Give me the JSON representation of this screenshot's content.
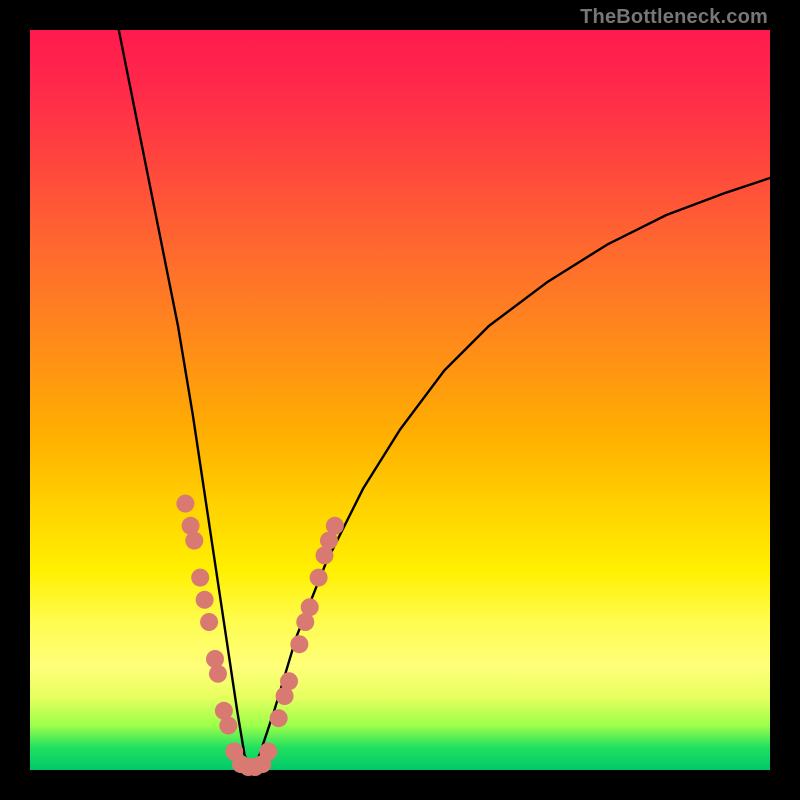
{
  "watermark": "TheBottleneck.com",
  "chart_data": {
    "type": "line",
    "title": "",
    "xlabel": "",
    "ylabel": "",
    "xlim": [
      0,
      100
    ],
    "ylim": [
      0,
      100
    ],
    "notes": "V-shaped bottleneck curve on a vertical gradient background (red top → green bottom). Salmon circular markers clustered near the valley. No axis ticks or labels rendered.",
    "series": [
      {
        "name": "bottleneck-curve",
        "x": [
          12,
          14,
          16,
          18,
          20,
          22,
          23.5,
          25,
          26.5,
          28,
          29,
          30,
          31,
          33,
          36,
          40,
          45,
          50,
          56,
          62,
          70,
          78,
          86,
          94,
          100
        ],
        "y": [
          100,
          90,
          80,
          70,
          60,
          48,
          38,
          28,
          18,
          8,
          2,
          0,
          2,
          8,
          18,
          28,
          38,
          46,
          54,
          60,
          66,
          71,
          75,
          78,
          80
        ]
      }
    ],
    "markers": [
      {
        "x": 21.0,
        "y": 36
      },
      {
        "x": 21.7,
        "y": 33
      },
      {
        "x": 22.2,
        "y": 31
      },
      {
        "x": 23.0,
        "y": 26
      },
      {
        "x": 23.6,
        "y": 23
      },
      {
        "x": 24.2,
        "y": 20
      },
      {
        "x": 25.0,
        "y": 15
      },
      {
        "x": 25.4,
        "y": 13
      },
      {
        "x": 26.2,
        "y": 8
      },
      {
        "x": 26.8,
        "y": 6
      },
      {
        "x": 27.6,
        "y": 2.5
      },
      {
        "x": 28.5,
        "y": 0.8
      },
      {
        "x": 29.5,
        "y": 0.4
      },
      {
        "x": 30.4,
        "y": 0.4
      },
      {
        "x": 31.4,
        "y": 0.8
      },
      {
        "x": 32.2,
        "y": 2.5
      },
      {
        "x": 33.6,
        "y": 7
      },
      {
        "x": 34.4,
        "y": 10
      },
      {
        "x": 35.0,
        "y": 12
      },
      {
        "x": 36.4,
        "y": 17
      },
      {
        "x": 37.2,
        "y": 20
      },
      {
        "x": 37.8,
        "y": 22
      },
      {
        "x": 39.0,
        "y": 26
      },
      {
        "x": 39.8,
        "y": 29
      },
      {
        "x": 40.4,
        "y": 31
      },
      {
        "x": 41.2,
        "y": 33
      }
    ],
    "marker_color": "#d97a72",
    "curve_color": "#000000"
  }
}
